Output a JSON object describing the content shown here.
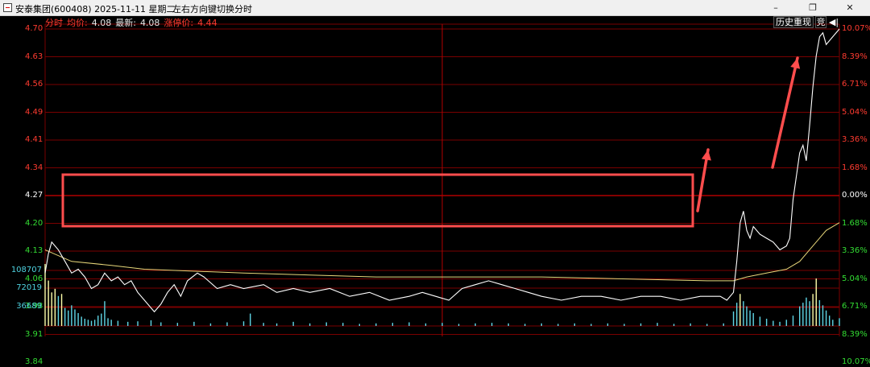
{
  "window": {
    "title": "安泰集团(600408) 2025-11-11 星期二",
    "hint": "左右方向键切换分时",
    "minimize": "–",
    "restore": "❐",
    "close": "✕"
  },
  "info": {
    "mode": "分时",
    "avg_label": "均价:",
    "avg_value": "4.08",
    "latest_label": "最新:",
    "latest_value": "4.08",
    "limit_label": "涨停价:",
    "limit_value": "4.44"
  },
  "toolbar": {
    "history_label": "历史重现",
    "auction_label": "竞",
    "back_icon": "back-to-start-icon"
  },
  "colors": {
    "price_line": "#ffffff",
    "avg_line": "#e8d77a",
    "grid": "#7a0000",
    "center_line": "#b00000",
    "up": "#ff3b30",
    "down": "#33dd33",
    "highlight_box": "#ff4d4d",
    "arrow": "#ff4d4d",
    "volume_label": "#4fd2e0"
  },
  "axes": {
    "price_left": [
      "4.70",
      "4.63",
      "4.56",
      "4.49",
      "4.41",
      "4.34",
      "4.27",
      "4.20",
      "4.13",
      "4.06",
      "3.98",
      "3.91",
      "3.84"
    ],
    "pct_right": [
      "10.07%",
      "8.39%",
      "6.71%",
      "5.04%",
      "3.36%",
      "1.68%",
      "0.00%",
      "1.68%",
      "3.36%",
      "5.04%",
      "6.71%",
      "8.39%",
      "10.07%"
    ],
    "volume_left": [
      "108707",
      "72019",
      "36689"
    ]
  },
  "chart_data": {
    "type": "line",
    "prev_close": 4.27,
    "ylim": [
      3.84,
      4.7
    ],
    "total_minutes": 240,
    "series": [
      {
        "key": "price",
        "points": [
          [
            0,
            4.07
          ],
          [
            1,
            4.12
          ],
          [
            2,
            4.15
          ],
          [
            4,
            4.13
          ],
          [
            6,
            4.1
          ],
          [
            8,
            4.07
          ],
          [
            10,
            4.08
          ],
          [
            12,
            4.06
          ],
          [
            14,
            4.03
          ],
          [
            16,
            4.04
          ],
          [
            18,
            4.07
          ],
          [
            20,
            4.05
          ],
          [
            22,
            4.06
          ],
          [
            24,
            4.04
          ],
          [
            26,
            4.05
          ],
          [
            28,
            4.02
          ],
          [
            30,
            4.0
          ],
          [
            32,
            3.98
          ],
          [
            33,
            3.97
          ],
          [
            35,
            3.99
          ],
          [
            37,
            4.02
          ],
          [
            39,
            4.04
          ],
          [
            41,
            4.01
          ],
          [
            43,
            4.05
          ],
          [
            46,
            4.07
          ],
          [
            48,
            4.06
          ],
          [
            52,
            4.03
          ],
          [
            56,
            4.04
          ],
          [
            60,
            4.03
          ],
          [
            66,
            4.04
          ],
          [
            70,
            4.02
          ],
          [
            75,
            4.03
          ],
          [
            80,
            4.02
          ],
          [
            86,
            4.03
          ],
          [
            92,
            4.01
          ],
          [
            98,
            4.02
          ],
          [
            104,
            4.0
          ],
          [
            110,
            4.01
          ],
          [
            114,
            4.02
          ],
          [
            118,
            4.01
          ],
          [
            122,
            4.0
          ],
          [
            126,
            4.03
          ],
          [
            130,
            4.04
          ],
          [
            134,
            4.05
          ],
          [
            138,
            4.04
          ],
          [
            142,
            4.03
          ],
          [
            146,
            4.02
          ],
          [
            150,
            4.01
          ],
          [
            156,
            4.0
          ],
          [
            162,
            4.01
          ],
          [
            168,
            4.01
          ],
          [
            174,
            4.0
          ],
          [
            180,
            4.01
          ],
          [
            186,
            4.01
          ],
          [
            192,
            4.0
          ],
          [
            198,
            4.01
          ],
          [
            204,
            4.01
          ],
          [
            206,
            4.0
          ],
          [
            208,
            4.02
          ],
          [
            209,
            4.1
          ],
          [
            210,
            4.2
          ],
          [
            211,
            4.23
          ],
          [
            212,
            4.18
          ],
          [
            213,
            4.16
          ],
          [
            214,
            4.19
          ],
          [
            216,
            4.17
          ],
          [
            218,
            4.16
          ],
          [
            220,
            4.15
          ],
          [
            222,
            4.13
          ],
          [
            224,
            4.14
          ],
          [
            225,
            4.16
          ],
          [
            226,
            4.26
          ],
          [
            227,
            4.32
          ],
          [
            228,
            4.38
          ],
          [
            229,
            4.4
          ],
          [
            230,
            4.36
          ],
          [
            231,
            4.45
          ],
          [
            232,
            4.55
          ],
          [
            233,
            4.63
          ],
          [
            234,
            4.68
          ],
          [
            235,
            4.69
          ],
          [
            236,
            4.66
          ],
          [
            238,
            4.68
          ],
          [
            240,
            4.7
          ]
        ]
      },
      {
        "key": "avg",
        "points": [
          [
            0,
            4.13
          ],
          [
            8,
            4.1
          ],
          [
            20,
            4.09
          ],
          [
            30,
            4.08
          ],
          [
            60,
            4.07
          ],
          [
            100,
            4.06
          ],
          [
            150,
            4.06
          ],
          [
            200,
            4.05
          ],
          [
            208,
            4.05
          ],
          [
            212,
            4.06
          ],
          [
            218,
            4.07
          ],
          [
            224,
            4.08
          ],
          [
            228,
            4.1
          ],
          [
            232,
            4.14
          ],
          [
            236,
            4.18
          ],
          [
            240,
            4.2
          ]
        ]
      }
    ],
    "volume": {
      "ylim": [
        0,
        145000
      ],
      "bars": [
        [
          0,
          120000
        ],
        [
          1,
          88000
        ],
        [
          2,
          65000
        ],
        [
          3,
          72000
        ],
        [
          4,
          58000
        ],
        [
          5,
          62000
        ],
        [
          6,
          35000
        ],
        [
          7,
          30000
        ],
        [
          8,
          40000
        ],
        [
          9,
          32000
        ],
        [
          10,
          25000
        ],
        [
          11,
          18000
        ],
        [
          12,
          14000
        ],
        [
          13,
          12000
        ],
        [
          14,
          10000
        ],
        [
          15,
          12000
        ],
        [
          16,
          20000
        ],
        [
          17,
          24000
        ],
        [
          18,
          48000
        ],
        [
          19,
          15000
        ],
        [
          20,
          12000
        ],
        [
          22,
          10000
        ],
        [
          25,
          8000
        ],
        [
          28,
          9000
        ],
        [
          32,
          11000
        ],
        [
          35,
          7000
        ],
        [
          40,
          6000
        ],
        [
          45,
          8000
        ],
        [
          50,
          5000
        ],
        [
          55,
          7000
        ],
        [
          60,
          9000
        ],
        [
          62,
          24000
        ],
        [
          66,
          6000
        ],
        [
          70,
          5000
        ],
        [
          75,
          8000
        ],
        [
          80,
          5000
        ],
        [
          85,
          7000
        ],
        [
          90,
          6000
        ],
        [
          95,
          4000
        ],
        [
          100,
          5000
        ],
        [
          105,
          6000
        ],
        [
          110,
          7000
        ],
        [
          115,
          5000
        ],
        [
          120,
          6000
        ],
        [
          125,
          4000
        ],
        [
          130,
          5000
        ],
        [
          135,
          6000
        ],
        [
          140,
          5000
        ],
        [
          145,
          4000
        ],
        [
          150,
          5000
        ],
        [
          155,
          4000
        ],
        [
          160,
          5000
        ],
        [
          165,
          4000
        ],
        [
          170,
          5000
        ],
        [
          175,
          4000
        ],
        [
          180,
          5000
        ],
        [
          185,
          6000
        ],
        [
          190,
          4000
        ],
        [
          195,
          5000
        ],
        [
          200,
          4000
        ],
        [
          205,
          5000
        ],
        [
          208,
          28000
        ],
        [
          209,
          45000
        ],
        [
          210,
          62000
        ],
        [
          211,
          48000
        ],
        [
          212,
          38000
        ],
        [
          213,
          30000
        ],
        [
          214,
          25000
        ],
        [
          216,
          18000
        ],
        [
          218,
          14000
        ],
        [
          220,
          10000
        ],
        [
          222,
          8000
        ],
        [
          224,
          12000
        ],
        [
          226,
          20000
        ],
        [
          228,
          38000
        ],
        [
          229,
          45000
        ],
        [
          230,
          55000
        ],
        [
          231,
          48000
        ],
        [
          232,
          62000
        ],
        [
          233,
          92000
        ],
        [
          234,
          50000
        ],
        [
          235,
          40000
        ],
        [
          236,
          30000
        ],
        [
          237,
          20000
        ],
        [
          238,
          12000
        ],
        [
          240,
          15000
        ]
      ]
    }
  }
}
